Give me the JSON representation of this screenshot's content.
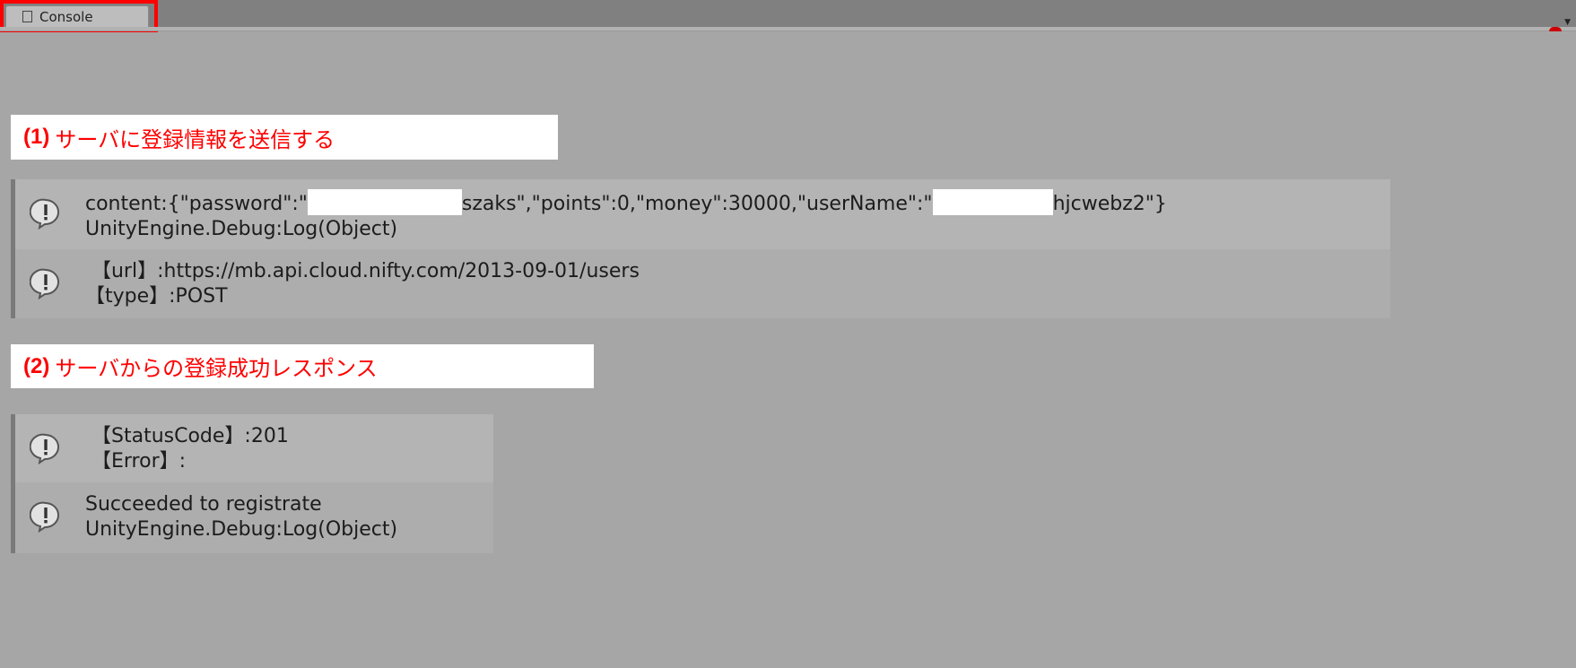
{
  "tab": {
    "title": "Console"
  },
  "annotations": [
    {
      "number": "(1)",
      "text": "サーバに登録情報を送信する"
    },
    {
      "number": "(2)",
      "text": "サーバからの登録成功レスポンス"
    }
  ],
  "colors": {
    "annotation_text": "#ff0000",
    "highlight_border": "#ff0000",
    "background": "#a6a6a6"
  },
  "logs_request": [
    {
      "icon": "warning-icon",
      "line1_prefix": "content:{\"password\":\"",
      "line1_middle": "szaks\",\"points\":0,\"money\":30000,\"userName\":\"",
      "line1_suffix": "hjcwebz2\"}",
      "line2": "UnityEngine.Debug:Log(Object)"
    },
    {
      "icon": "warning-icon",
      "line1": " 【url】:https://mb.api.cloud.nifty.com/2013-09-01/users",
      "line2": "【type】:POST"
    }
  ],
  "logs_response": [
    {
      "icon": "warning-icon",
      "line1": " 【StatusCode】:201",
      "line2": " 【Error】:"
    },
    {
      "icon": "warning-icon",
      "line1": "Succeeded to registrate",
      "line2": "UnityEngine.Debug:Log(Object)"
    }
  ]
}
